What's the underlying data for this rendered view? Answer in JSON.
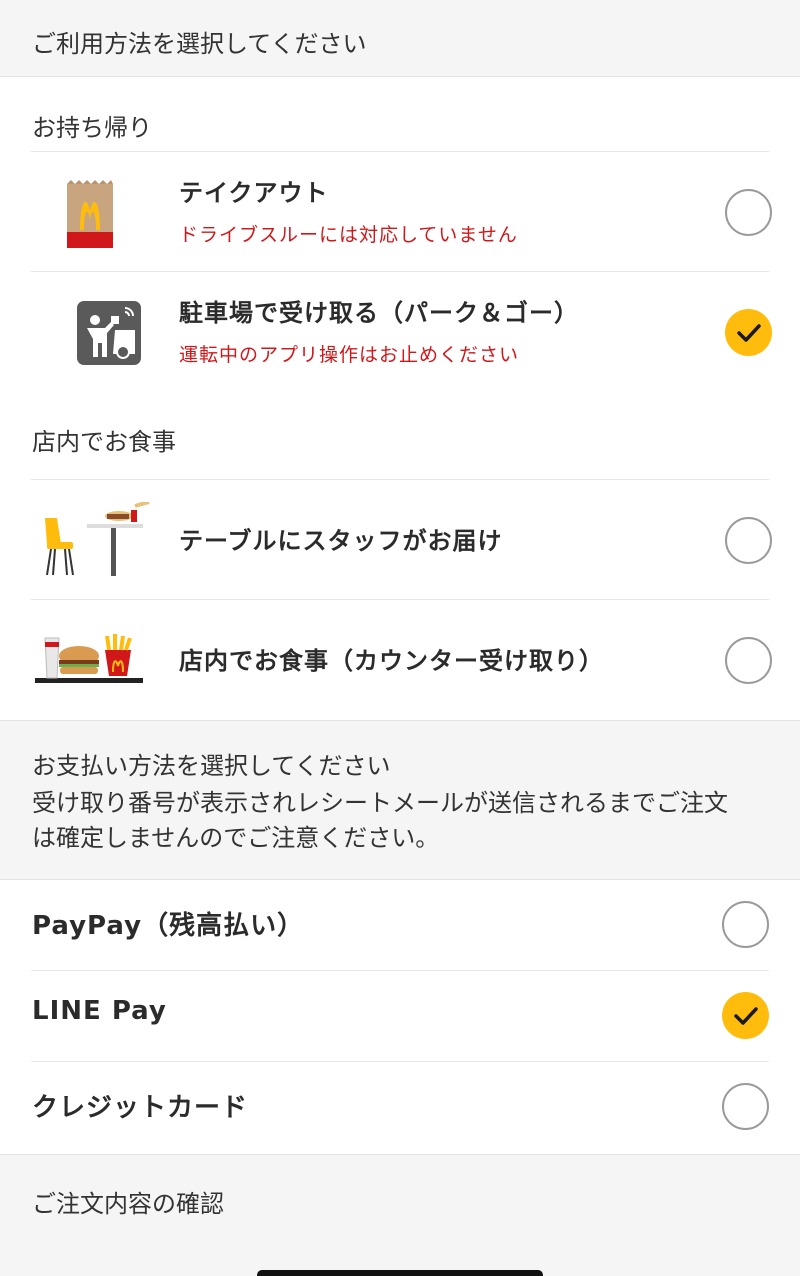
{
  "header": {
    "title": "ご利用方法を選択してください"
  },
  "takeout_section": {
    "title": "お持ち帰り",
    "options": [
      {
        "label": "テイクアウト",
        "note": "ドライブスルーには対応していません",
        "selected": false,
        "icon": "takeout-bag-icon"
      },
      {
        "label": "駐車場で受け取る（パーク＆ゴー）",
        "note": "運転中のアプリ操作はお止めください",
        "selected": true,
        "icon": "park-and-go-icon"
      }
    ]
  },
  "dine_in_section": {
    "title": "店内でお食事",
    "options": [
      {
        "label": "テーブルにスタッフがお届け",
        "selected": false,
        "icon": "table-service-icon"
      },
      {
        "label": "店内でお食事（カウンター受け取り）",
        "selected": false,
        "icon": "counter-tray-icon"
      }
    ]
  },
  "payment_section": {
    "title": "お支払い方法を選択してください",
    "note_line1": "受け取り番号が表示されレシートメールが送信されるまでご注文",
    "note_line2": "は確定しませんのでご注意ください。",
    "methods": [
      {
        "label": "PayPay（残高払い）",
        "selected": false
      },
      {
        "label": "LINE Pay",
        "selected": true
      },
      {
        "label": "クレジットカード",
        "selected": false
      }
    ]
  },
  "footer": {
    "confirm_label": "ご注文内容の確認"
  },
  "colors": {
    "accent": "#ffbc0d",
    "warning": "#d0181b",
    "section_bg": "#f5f5f5"
  }
}
